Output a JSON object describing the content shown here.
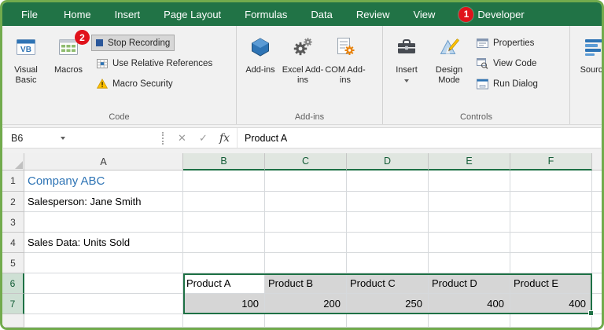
{
  "tabs": {
    "items": [
      {
        "label": "File"
      },
      {
        "label": "Home"
      },
      {
        "label": "Insert"
      },
      {
        "label": "Page Layout"
      },
      {
        "label": "Formulas"
      },
      {
        "label": "Data"
      },
      {
        "label": "Review"
      },
      {
        "label": "View"
      },
      {
        "label": "Developer"
      }
    ],
    "active": "Developer",
    "badge_developer": "1"
  },
  "ribbon": {
    "code_group": {
      "label": "Code",
      "visual_basic": "Visual Basic",
      "macros": "Macros",
      "stop_recording": "Stop Recording",
      "use_relative_references": "Use Relative References",
      "macro_security": "Macro Security",
      "badge": "2"
    },
    "addins_group": {
      "label": "Add-ins",
      "addins": "Add-ins",
      "excel_addins": "Excel Add-ins",
      "com_addins": "COM Add-ins"
    },
    "controls_group": {
      "label": "Controls",
      "insert": "Insert",
      "design_mode": "Design Mode",
      "properties": "Properties",
      "view_code": "View Code",
      "run_dialog": "Run Dialog"
    },
    "xml_group": {
      "source": "Source"
    }
  },
  "formula_bar": {
    "name_box": "B6",
    "icons": {
      "cancel": "✕",
      "enter": "✓",
      "fx": "fx"
    },
    "content": "Product A"
  },
  "sheet": {
    "columns": [
      "A",
      "B",
      "C",
      "D",
      "E",
      "F"
    ],
    "selected_columns": [
      "B",
      "C",
      "D",
      "E",
      "F"
    ],
    "active_cell": "B6",
    "selection": "B6:F7",
    "rows": [
      {
        "n": "1",
        "A": "Company ABC"
      },
      {
        "n": "2",
        "A": "Salesperson: Jane Smith"
      },
      {
        "n": "3"
      },
      {
        "n": "4",
        "A": "Sales Data: Units Sold"
      },
      {
        "n": "5"
      },
      {
        "n": "6",
        "B": "Product A",
        "C": "Product B",
        "D": "Product C",
        "E": "Product D",
        "F": "Product E"
      },
      {
        "n": "7",
        "B": "100",
        "C": "200",
        "D": "250",
        "E": "400",
        "F": "400"
      }
    ]
  },
  "colors": {
    "excel_green": "#217346",
    "frame_green": "#72AB4D",
    "badge_red": "#E0121B",
    "selection_fill": "#D6D6D6",
    "selection_border": "#1E7145",
    "heading_blue": "#2E74B5"
  }
}
